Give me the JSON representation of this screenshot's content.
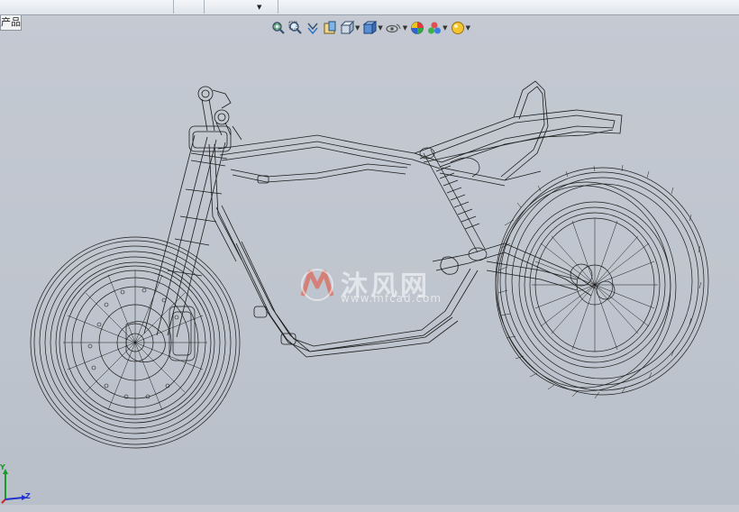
{
  "app": {
    "ribbon_tabs": [
      "",
      "",
      "",
      "",
      "",
      ""
    ],
    "feature_tree_tab": "产品"
  },
  "view_toolbar": {
    "buttons": [
      {
        "name": "zoom-to-fit-icon",
        "dropdown": false
      },
      {
        "name": "zoom-to-area-icon",
        "dropdown": false
      },
      {
        "name": "previous-view-icon",
        "dropdown": false
      },
      {
        "name": "section-view-icon",
        "dropdown": false
      },
      {
        "name": "view-orientation-icon",
        "dropdown": true
      },
      {
        "name": "display-style-icon",
        "dropdown": true
      },
      {
        "name": "hide-show-items-icon",
        "dropdown": true
      },
      {
        "name": "edit-appearance-icon",
        "dropdown": false
      },
      {
        "name": "apply-scene-icon",
        "dropdown": true
      },
      {
        "name": "view-settings-icon",
        "dropdown": true
      }
    ]
  },
  "watermark": {
    "title": "沐风网",
    "url": "www.mfcad.com"
  },
  "triad": {
    "y_label": "Y",
    "z_label": "Z"
  },
  "colors": {
    "background_top": "#c4c9d2",
    "wire": "#1a1a1a",
    "triad_y": "#1a9a2a",
    "triad_z": "#2233cc",
    "triad_x": "#cc2222"
  }
}
